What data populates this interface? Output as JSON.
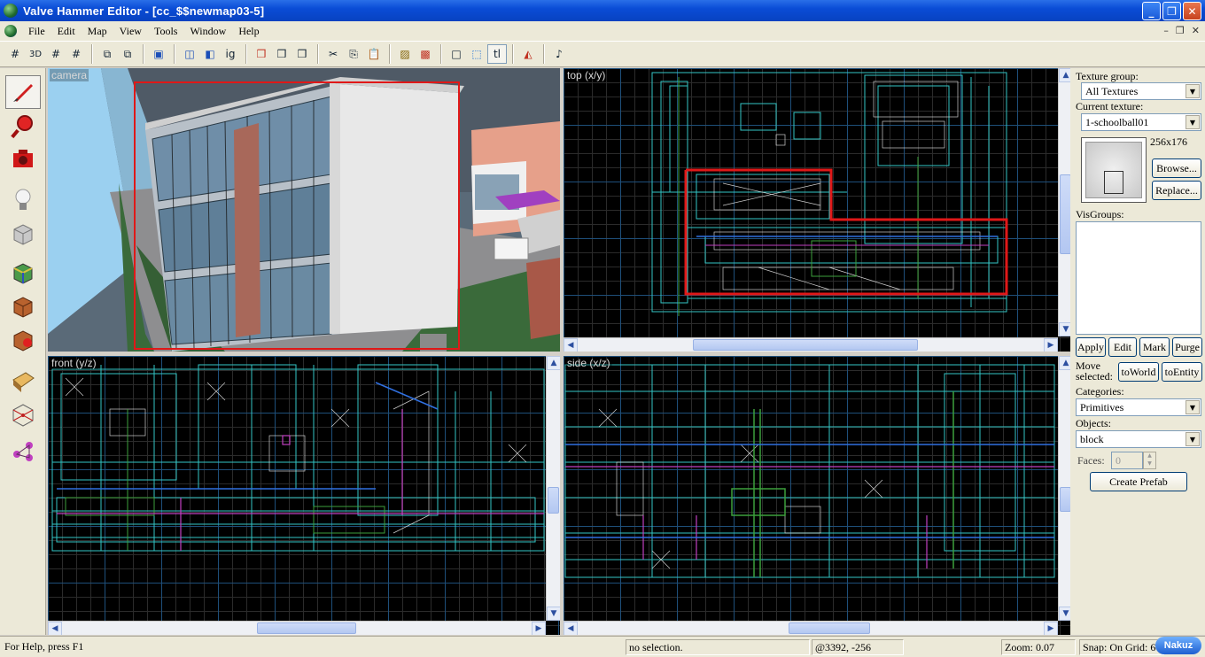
{
  "window": {
    "title": "Valve Hammer Editor - [cc_$$newmap03-5]",
    "buttons": {
      "minimize": "_",
      "maximize": "❐",
      "close": "✕"
    }
  },
  "menu": {
    "items": [
      "File",
      "Edit",
      "Map",
      "View",
      "Tools",
      "Window",
      "Help"
    ],
    "mdi": {
      "minimize": "–",
      "restore": "❐",
      "close": "✕"
    }
  },
  "toolbar": {
    "groups": [
      [
        "grid-toggle",
        "3d-grid",
        "grid-smaller",
        "grid-larger"
      ],
      [
        "group",
        "ungroup"
      ],
      [
        "load-window-state"
      ],
      [
        "hide-items",
        "show-items",
        "texture-lock"
      ],
      [
        "carve",
        "hollow",
        "make-box"
      ],
      [
        "cut",
        "copy",
        "paste"
      ],
      [
        "texture-apply",
        "decals"
      ],
      [
        "select-box",
        "select-lasso",
        "tl"
      ],
      [
        "run-map"
      ],
      [
        "sound"
      ]
    ],
    "tl_label": "tl"
  },
  "tools": [
    "selection",
    "magnify",
    "camera",
    "entity",
    "block",
    "texture",
    "apply-current-texture",
    "decal",
    "overlay",
    "clipping",
    "vertex-manipulation",
    "path"
  ],
  "viewports": {
    "camera": {
      "label": "camera"
    },
    "top": {
      "label": "top (x/y)"
    },
    "front": {
      "label": "front (y/z)"
    },
    "side": {
      "label": "side (x/z)"
    }
  },
  "right_panel": {
    "texture_group_label": "Texture group:",
    "texture_group_value": "All Textures",
    "current_texture_label": "Current texture:",
    "current_texture_value": "1-schoolball01",
    "texture_size": "256x176",
    "browse_button": "Browse...",
    "replace_button": "Replace...",
    "visgroups_label": "VisGroups:",
    "apply_button": "Apply",
    "edit_button": "Edit",
    "mark_button": "Mark",
    "purge_button": "Purge",
    "move_selected_label": "Move selected:",
    "to_world_button": "toWorld",
    "to_entity_button": "toEntity",
    "categories_label": "Categories:",
    "categories_value": "Primitives",
    "objects_label": "Objects:",
    "objects_value": "block",
    "faces_label": "Faces:",
    "faces_value": "0",
    "create_prefab_button": "Create Prefab"
  },
  "status": {
    "help": "For Help, press F1",
    "selection": "no selection.",
    "coords": "@3392, -256",
    "zoom": "Zoom: 0.07",
    "snap": "Snap: On Grid: 6",
    "watermark": "Nakuz"
  },
  "colors": {
    "selection_red": "#e01818",
    "titlebar_blue": "#0a4cd6",
    "brush_cyan": "#33c6c6",
    "brush_magenta": "#c040c0",
    "brush_green": "#3ca03c"
  }
}
